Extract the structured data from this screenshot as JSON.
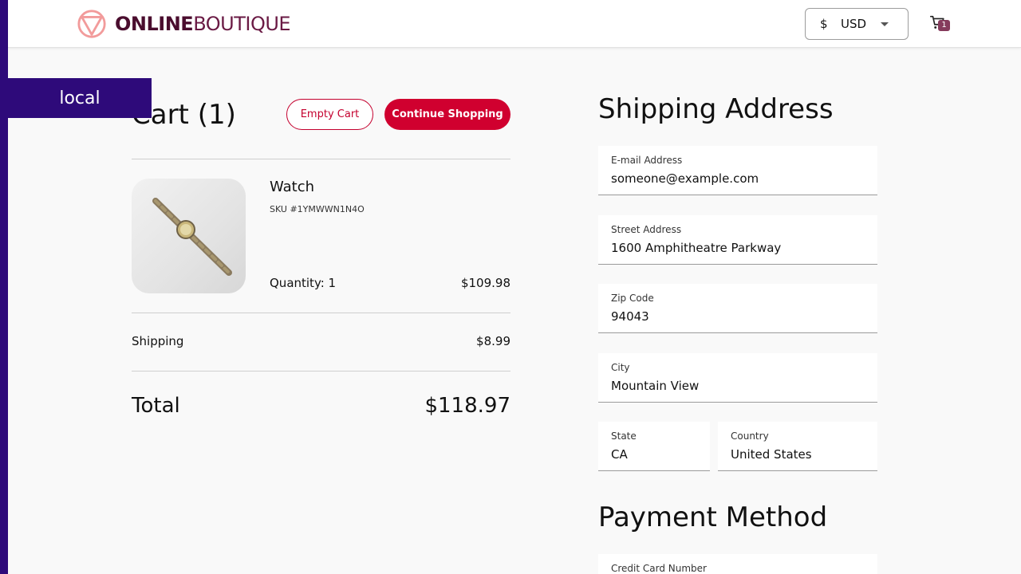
{
  "header": {
    "logo": {
      "part1": "ONLINE",
      "part2": "BOUTIQUE"
    },
    "currency": {
      "symbol": "$",
      "code": "USD"
    },
    "cart_count": "1"
  },
  "env_banner": "local",
  "cart": {
    "title": "Cart (1)",
    "empty_label": "Empty Cart",
    "continue_label": "Continue Shopping",
    "item": {
      "name": "Watch",
      "sku": "SKU #1YMWWN1N4O",
      "quantity": "Quantity: 1",
      "price": "$109.98"
    },
    "shipping_label": "Shipping",
    "shipping_value": "$8.99",
    "total_label": "Total",
    "total_value": "$118.97"
  },
  "shipping_address": {
    "title": "Shipping Address",
    "email": {
      "label": "E-mail Address",
      "value": "someone@example.com"
    },
    "street": {
      "label": "Street Address",
      "value": "1600 Amphitheatre Parkway"
    },
    "zip": {
      "label": "Zip Code",
      "value": "94043"
    },
    "city": {
      "label": "City",
      "value": "Mountain View"
    },
    "state": {
      "label": "State",
      "value": "CA"
    },
    "country": {
      "label": "Country",
      "value": "United States"
    }
  },
  "payment": {
    "title": "Payment Method",
    "card_number": {
      "label": "Credit Card Number"
    }
  },
  "colors": {
    "accent": "#d0002f",
    "brand": "#4a0d2e",
    "banner": "#2e0a7a",
    "badge": "#853b5c"
  }
}
